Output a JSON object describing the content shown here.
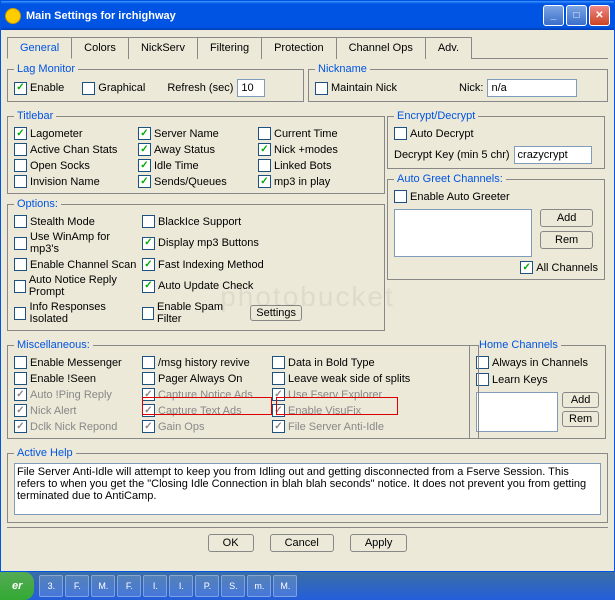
{
  "window": {
    "title": "Main Settings for irchighway"
  },
  "tabs": [
    "General",
    "Colors",
    "NickServ",
    "Filtering",
    "Protection",
    "Channel Ops",
    "Adv."
  ],
  "lag": {
    "legend": "Lag Monitor",
    "enable": "Enable",
    "graphical": "Graphical",
    "refresh_lbl": "Refresh (sec)",
    "refresh_val": "10"
  },
  "nick": {
    "legend": "Nickname",
    "maintain": "Maintain Nick",
    "nick_lbl": "Nick:",
    "nick_val": "n/a"
  },
  "titlebar": {
    "legend": "Titlebar",
    "items": [
      "Lagometer",
      "Active Chan Stats",
      "Open Socks",
      "Invision Name",
      "Server Name",
      "Away Status",
      "Idle Time",
      "Sends/Queues",
      "Current Time",
      "Nick +modes",
      "Linked Bots",
      "mp3 in play"
    ]
  },
  "encrypt": {
    "legend": "Encrypt/Decrypt",
    "auto": "Auto Decrypt",
    "key_lbl": "Decrypt Key (min 5 chr)",
    "key_val": "crazycrypt"
  },
  "options": {
    "legend": "Options:",
    "l": [
      "Stealth Mode",
      "Use WinAmp for mp3's",
      "Enable Channel Scan",
      "Auto Notice Reply Prompt",
      "Info Responses Isolated"
    ],
    "r": [
      "BlackIce Support",
      "Display mp3 Buttons",
      "Fast Indexing Method",
      "Auto Update Check",
      "Enable Spam Filter"
    ],
    "settings": "Settings"
  },
  "greet": {
    "legend": "Auto Greet Channels:",
    "enable": "Enable Auto Greeter",
    "add": "Add",
    "rem": "Rem",
    "all": "All Channels"
  },
  "misc": {
    "legend": "Miscellaneous:",
    "a": [
      "Enable Messenger",
      "Enable !Seen",
      "Auto !Ping Reply",
      "Nick Alert",
      "Dclk Nick Repond"
    ],
    "b": [
      "/msg history revive",
      "Pager Always On",
      "Capture Notice Ads",
      "Capture Text Ads",
      "Gain Ops"
    ],
    "c": [
      "Data in Bold Type",
      "Leave weak side of splits",
      "Use Fserv Explorer",
      "Enable VisuFix",
      "File Server Anti-Idle"
    ]
  },
  "home": {
    "legend": "Home Channels",
    "always": "Always in Channels",
    "learn": "Learn Keys",
    "add": "Add",
    "rem": "Rem"
  },
  "help": {
    "legend": "Active Help",
    "text": "File Server Anti-Idle will attempt to keep you from Idling out and getting disconnected from a Fserve Session. This refers to when you get the \"Closing Idle Connection in blah blah seconds\" notice. It does not prevent you from getting terminated due to AntiCamp."
  },
  "btns": {
    "ok": "OK",
    "cancel": "Cancel",
    "apply": "Apply"
  },
  "taskbar": {
    "start": "er",
    "tasks": [
      "3.",
      "F.",
      "M.",
      "F.",
      "I.",
      "I.",
      "P.",
      "S.",
      "m.",
      "M."
    ]
  },
  "wm": "photobucket"
}
